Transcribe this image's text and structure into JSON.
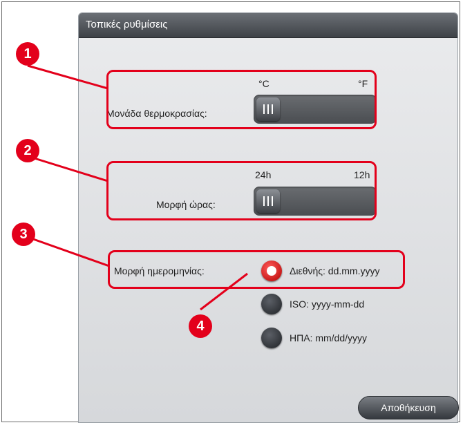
{
  "window": {
    "title": "Τοπικές ρυθμίσεις"
  },
  "temperature": {
    "label": "Μονάδα θερμοκρασίας:",
    "option_left": "°C",
    "option_right": "°F",
    "selected": "°C"
  },
  "time_format": {
    "label": "Μορφή ώρας:",
    "option_left": "24h",
    "option_right": "12h",
    "selected": "24h"
  },
  "date_format": {
    "label": "Μορφή ημερομηνίας:",
    "options": [
      {
        "label": "Διεθνής: dd.mm.yyyy",
        "selected": true
      },
      {
        "label": "ISO: yyyy-mm-dd",
        "selected": false
      },
      {
        "label": "ΗΠΑ: mm/dd/yyyy",
        "selected": false
      }
    ]
  },
  "buttons": {
    "save": "Αποθήκευση"
  },
  "callouts": [
    "1",
    "2",
    "3",
    "4"
  ],
  "colors": {
    "callout_red": "#e3001b",
    "selected_radio": "#d9001a"
  }
}
